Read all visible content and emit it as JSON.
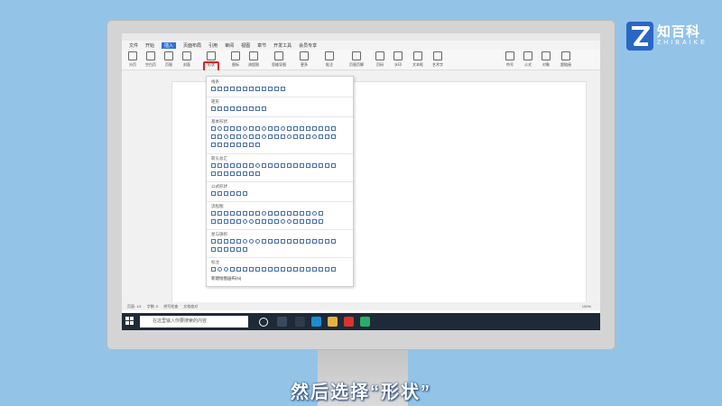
{
  "menu": {
    "items": [
      "文件",
      "开始",
      "插入",
      "页面布局",
      "引用",
      "审阅",
      "视图",
      "章节",
      "开发工具",
      "会员专享"
    ],
    "active_index": 2
  },
  "ribbon": {
    "buttons": [
      "分页",
      "空白页",
      "页眉",
      "封面",
      "形状",
      "图标",
      "流程图",
      "思维导图",
      "更多",
      "批注",
      "页眉页脚",
      "页码",
      "水印",
      "文本框",
      "艺术字",
      "符号",
      "公式",
      "对象",
      "超链接"
    ]
  },
  "dropdown": {
    "sections": [
      "线条",
      "矩形",
      "基本形状",
      "箭头总汇",
      "公式形状",
      "流程图",
      "星与旗帜",
      "标注"
    ],
    "footer": "新建绘图画布(N)"
  },
  "status": {
    "page": "页面: 1/1",
    "words": "字数: 0",
    "spell": "拼写检查",
    "doc_check": "文档校对",
    "zoom": "100%"
  },
  "taskbar": {
    "search_placeholder": "在这里输入你要搜索的内容"
  },
  "logo": {
    "title": "知百科",
    "subtitle": "ZHIBAIKE"
  },
  "caption": "然后选择“形状”",
  "colors": {
    "background": "#93c4e8",
    "highlight": "#e02020",
    "accent": "#2f6fd6",
    "logo": "#2a66c7"
  }
}
